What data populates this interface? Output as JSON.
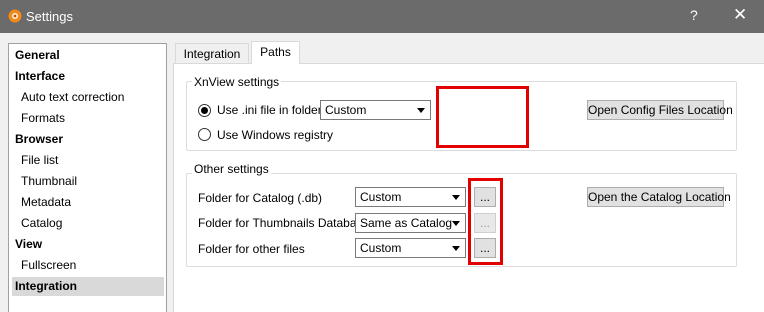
{
  "window": {
    "title": "Settings",
    "help_glyph": "?",
    "close_glyph": "✕"
  },
  "sidebar": {
    "items": [
      {
        "label": "General",
        "type": "category"
      },
      {
        "label": "Interface",
        "type": "category"
      },
      {
        "label": "Auto text correction",
        "type": "sub"
      },
      {
        "label": "Formats",
        "type": "sub"
      },
      {
        "label": "Browser",
        "type": "category"
      },
      {
        "label": "File list",
        "type": "sub"
      },
      {
        "label": "Thumbnail",
        "type": "sub"
      },
      {
        "label": "Metadata",
        "type": "sub"
      },
      {
        "label": "Catalog",
        "type": "sub"
      },
      {
        "label": "View",
        "type": "category"
      },
      {
        "label": "Fullscreen",
        "type": "sub"
      },
      {
        "label": "Integration",
        "type": "category",
        "selected": true
      }
    ]
  },
  "tabs": [
    {
      "label": "Integration",
      "active": false
    },
    {
      "label": "Paths",
      "active": true
    }
  ],
  "xnview_settings": {
    "group_label": "XnView settings",
    "radio_ini_label": "Use .ini file in folder",
    "radio_registry_label": "Use Windows registry",
    "selected_option": "Use .ini file in folder",
    "ini_folder_combo_value": "Custom",
    "open_config_button": "Open Config Files Location"
  },
  "other_settings": {
    "group_label": "Other settings",
    "rows": [
      {
        "label": "Folder for Catalog (.db)",
        "combo_value": "Custom",
        "browse_label": "...",
        "browse_enabled": true
      },
      {
        "label": "Folder for Thumbnails Database",
        "combo_value": "Same as Catalog",
        "browse_label": "...",
        "browse_enabled": false
      },
      {
        "label": "Folder for other files",
        "combo_value": "Custom",
        "browse_label": "...",
        "browse_enabled": true
      }
    ],
    "open_catalog_button": "Open the Catalog Location"
  },
  "colors": {
    "titlebar": "#6b6b6b",
    "highlight_box": "#e30000",
    "selection": "#d9d9d9"
  }
}
